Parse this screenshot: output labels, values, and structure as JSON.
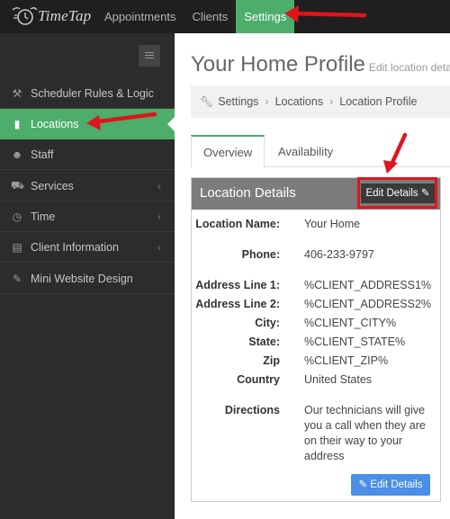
{
  "brand": {
    "name": "TimeTap"
  },
  "topnav": {
    "items": [
      "Appointments",
      "Clients",
      "Settings"
    ]
  },
  "sidebar": {
    "items": [
      {
        "label": "Scheduler Rules & Logic",
        "icon": "gavel-icon"
      },
      {
        "label": "Locations",
        "icon": "building-icon"
      },
      {
        "label": "Staff",
        "icon": "users-icon"
      },
      {
        "label": "Services",
        "icon": "cart-icon"
      },
      {
        "label": "Time",
        "icon": "clock-icon"
      },
      {
        "label": "Client Information",
        "icon": "id-card-icon"
      },
      {
        "label": "Mini Website Design",
        "icon": "edit-icon"
      }
    ]
  },
  "page": {
    "title": "Your Home Profile",
    "subtitle": "Edit location deta"
  },
  "breadcrumb": [
    "Settings",
    "Locations",
    "Location Profile"
  ],
  "tabs": [
    "Overview",
    "Availability"
  ],
  "panel": {
    "title": "Location Details",
    "edit_label": "Edit Details",
    "fields": [
      {
        "label": "Location Name:",
        "value": "Your Home"
      },
      {
        "label": "Phone:",
        "value": "406-233-9797"
      },
      {
        "label": "Address Line 1:",
        "value": "%CLIENT_ADDRESS1%"
      },
      {
        "label": "Address Line 2:",
        "value": "%CLIENT_ADDRESS2%"
      },
      {
        "label": "City:",
        "value": "%CLIENT_CITY%"
      },
      {
        "label": "State:",
        "value": "%CLIENT_STATE%"
      },
      {
        "label": "Zip",
        "value": "%CLIENT_ZIP%"
      },
      {
        "label": "Country",
        "value": "United States"
      }
    ],
    "directions_label": "Directions",
    "directions_value": "Our technicians will give you a call when they are on their way to your address",
    "bottom_button": "Edit Details"
  },
  "colors": {
    "accent": "#4cae6a",
    "annotation": "#e0141b",
    "button": "#4a8ee6"
  }
}
